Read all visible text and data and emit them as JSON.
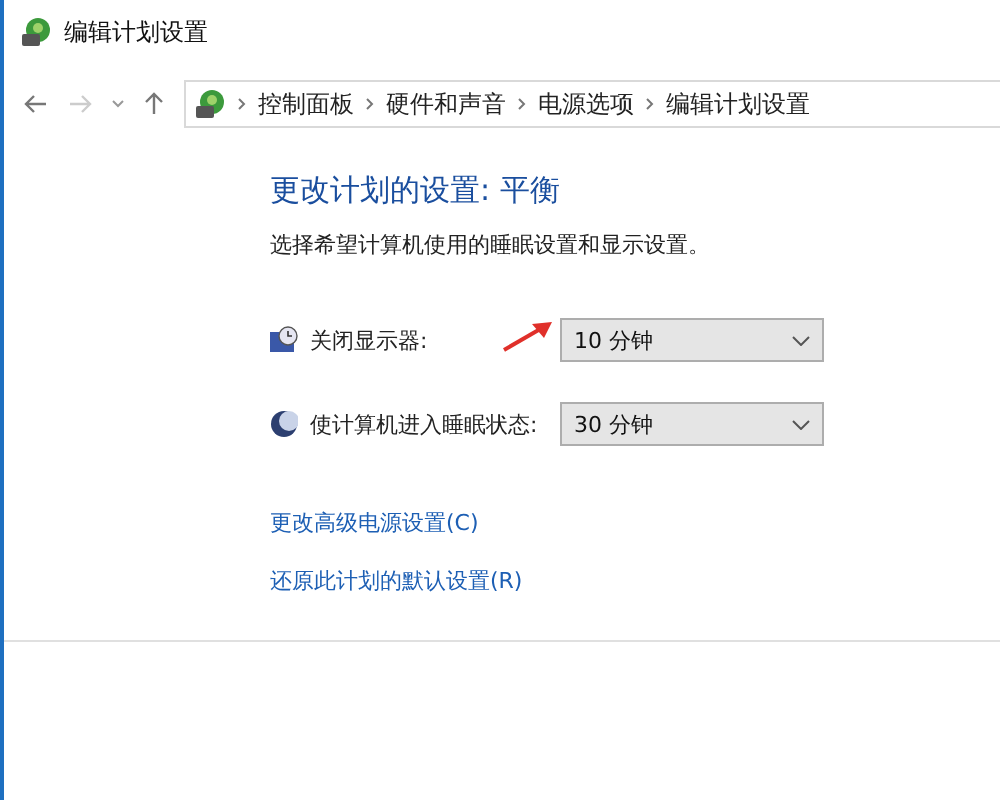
{
  "window": {
    "title": "编辑计划设置"
  },
  "breadcrumb": [
    "控制面板",
    "硬件和声音",
    "电源选项",
    "编辑计划设置"
  ],
  "heading": "更改计划的设置: 平衡",
  "description": "选择希望计算机使用的睡眠设置和显示设置。",
  "settings": [
    {
      "kind": "display",
      "label": "关闭显示器:",
      "value": "10 分钟"
    },
    {
      "kind": "sleep",
      "label": "使计算机进入睡眠状态:",
      "value": "30 分钟"
    }
  ],
  "links": [
    "更改高级电源设置(C)",
    "还原此计划的默认设置(R)"
  ]
}
